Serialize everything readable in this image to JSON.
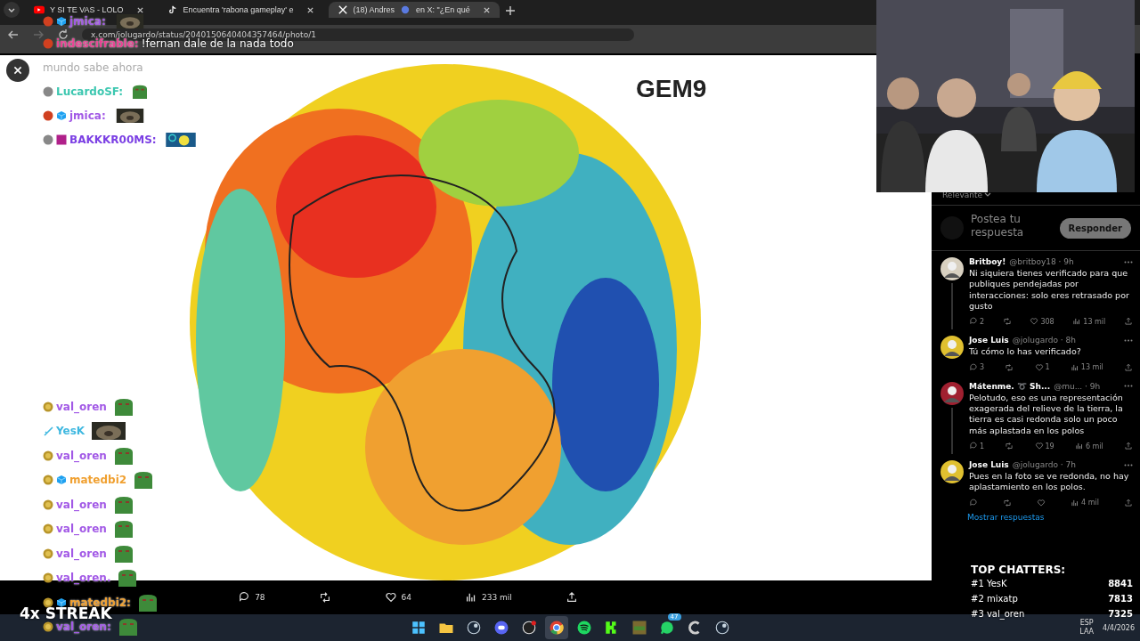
{
  "browser": {
    "tabs": [
      {
        "title": "Y SI TE VAS - LOLO",
        "selected": false
      },
      {
        "title": "Encuentra 'rabona gameplay' e",
        "selected": false
      },
      {
        "title": "(18) Andres",
        "title_after": "en X: \"¿En qué",
        "selected": true
      }
    ],
    "address": "x.com/jolugardo/status/2040150640404357464/photo/1"
  },
  "viewer": {
    "label": "GEM9",
    "actions": [
      {
        "kind": "reply",
        "count": "78"
      },
      {
        "kind": "repost"
      },
      {
        "kind": "like",
        "count": "64"
      },
      {
        "kind": "views",
        "count": "233 mil"
      },
      {
        "kind": "share"
      }
    ]
  },
  "replies": {
    "sort": "Relevante",
    "compose": {
      "placeholder": "Postea tu respuesta",
      "button": "Responder"
    },
    "tweets": [
      {
        "name": "Britboy!",
        "meta": "@britboy18 · 9h",
        "text": "Ni siquiera tienes verificado para que publiques pendejadas por interacciones: solo eres retrasado por gusto",
        "replies": "2",
        "likes": "308",
        "views": "13 mil",
        "thread": true
      },
      {
        "name": "Jose Luis",
        "meta": "@jolugardo · 8h",
        "text": "Tú cómo lo has verificado?",
        "replies": "3",
        "likes": "1",
        "views": "13 mil",
        "thread": false
      },
      {
        "name": "Mátenme. ➰ Sh...",
        "meta": "@mu... · 9h",
        "text": "Pelotudo, eso es una representación exagerada del relieve de la tierra, la tierra es casi redonda solo un poco más aplastada en los polos",
        "replies": "1",
        "likes": "19",
        "views": "6 mil",
        "thread": true
      },
      {
        "name": "Jose Luis",
        "meta": "@jolugardo · 7h",
        "text": "Pues en la foto se ve redonda, no hay aplastamiento en los polos.",
        "views": "4 mil",
        "thread": false
      }
    ],
    "more": "Mostrar respuestas"
  },
  "chat_top": [
    {
      "user": "jmica:",
      "color": "#a259e6",
      "kind": "seal_red_cube"
    },
    {
      "user": "indescifrable:",
      "color": "#e84393",
      "kind": "text_red",
      "text": "!fernan dale de la nada todo"
    },
    {
      "color": "#aaaaaa",
      "kind": "text",
      "text": "mundo sabe ahora"
    },
    {
      "user": "LucardoSF:",
      "color": "#3cc7b0",
      "kind": "frog_grey"
    },
    {
      "user": "jmica:",
      "color": "#a259e6",
      "kind": "seal_red_cube"
    },
    {
      "user": "BAKKKR00MS:",
      "color": "#7b3fe4",
      "kind": "photo_grey_square"
    }
  ],
  "chat_bottom": [
    {
      "user": "val_oren",
      "color": "#a259e6",
      "kind": "frog_coin"
    },
    {
      "user": "YesK",
      "color": "#3fb8e0",
      "kind": "seal_sword"
    },
    {
      "user": "val_oren",
      "color": "#a259e6",
      "kind": "frog_coin"
    },
    {
      "user": "matedbi2",
      "color": "#f0a030",
      "kind": "frog_coin_cube"
    },
    {
      "user": "val_oren",
      "color": "#a259e6",
      "kind": "frog_coin"
    },
    {
      "user": "val_oren",
      "color": "#a259e6",
      "kind": "frog_coin"
    },
    {
      "user": "val_oren",
      "color": "#a259e6",
      "kind": "frog_coin"
    },
    {
      "user": "val_oren.",
      "color": "#a259e6",
      "kind": "frog_coin"
    },
    {
      "user": "matedbi2:",
      "color": "#f0a030",
      "kind": "frog_coin_cube"
    },
    {
      "user": "val_oren:",
      "color": "#a259e6",
      "kind": "frog_coin"
    }
  ],
  "streak": "4x STREAK",
  "top_chatters": {
    "title": "TOP CHATTERS:",
    "rows": [
      {
        "rank": "#1 YesK",
        "score": "8841"
      },
      {
        "rank": "#2 mixatp",
        "score": "7813"
      },
      {
        "rank": "#3 val_oren",
        "score": "7325"
      }
    ]
  },
  "taskbar": {
    "apps": [
      {
        "kind": "start",
        "selected": false
      },
      {
        "kind": "folder",
        "selected": false
      },
      {
        "kind": "steam",
        "selected": false
      },
      {
        "kind": "discord",
        "selected": false
      },
      {
        "kind": "obs",
        "selected": false
      },
      {
        "kind": "chrome",
        "selected": true
      },
      {
        "kind": "spotify",
        "selected": false
      },
      {
        "kind": "kick",
        "selected": false
      },
      {
        "kind": "game",
        "selected": false
      },
      {
        "kind": "whatsapp",
        "selected": false,
        "badge": "47"
      },
      {
        "kind": "ccleaner",
        "selected": false
      },
      {
        "kind": "steam",
        "selected": false
      }
    ],
    "language": "ESP",
    "layout": "LAA",
    "date": "4/4/2026"
  }
}
